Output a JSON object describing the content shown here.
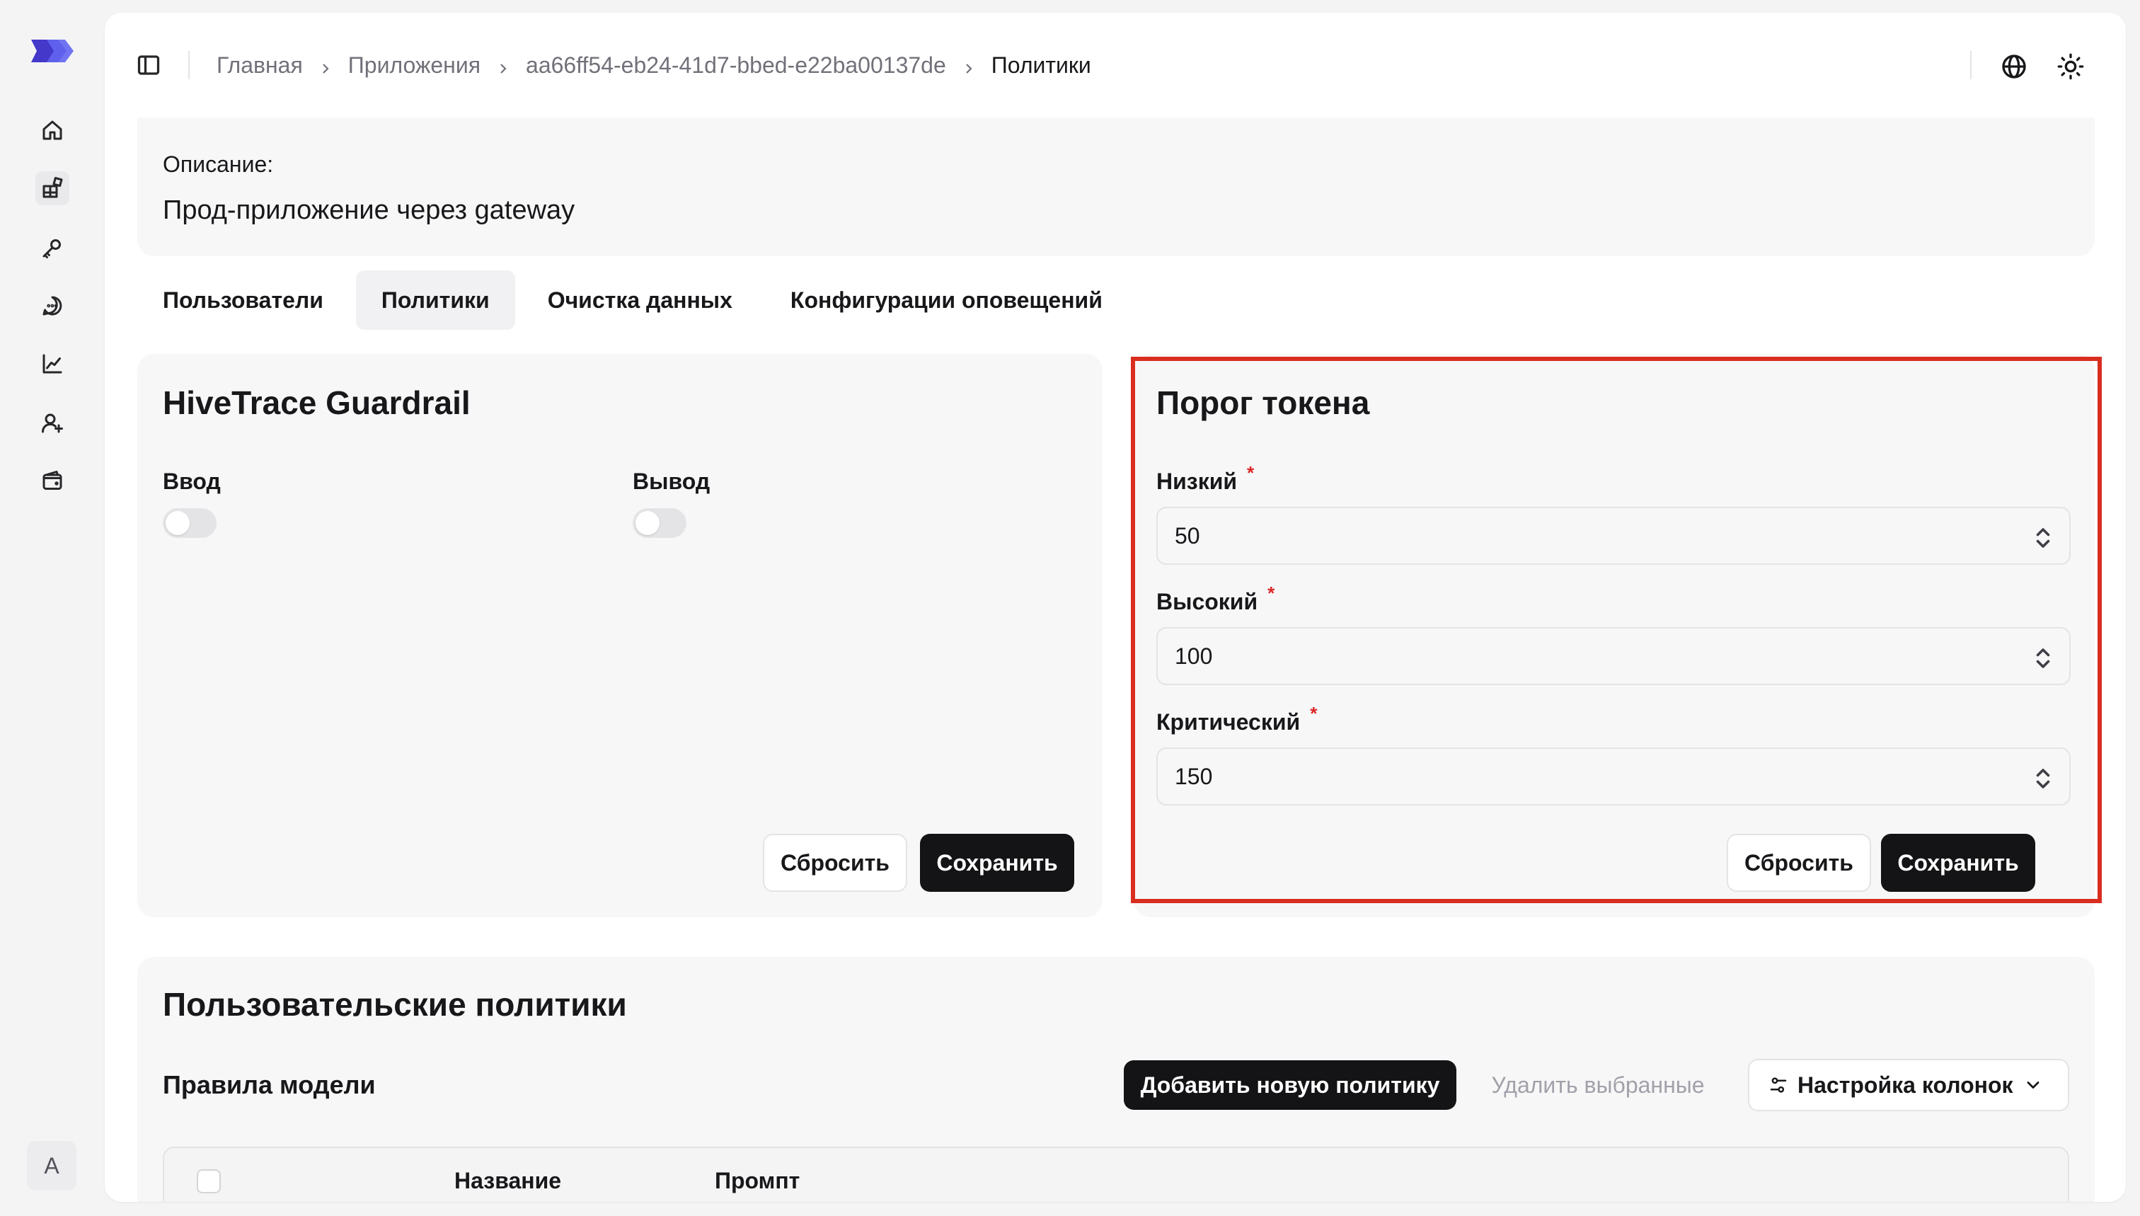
{
  "breadcrumb": {
    "items": [
      "Главная",
      "Приложения",
      "aa66ff54-eb24-41d7-bbed-e22ba00137de"
    ],
    "current": "Политики"
  },
  "user": {
    "avatar_initial": "A"
  },
  "app": {
    "description_label": "Описание:",
    "description_value": "Прод-приложение через gateway"
  },
  "tabs": [
    {
      "label": "Пользователи",
      "active": false
    },
    {
      "label": "Политики",
      "active": true
    },
    {
      "label": "Очистка данных",
      "active": false
    },
    {
      "label": "Конфигурации оповещений",
      "active": false
    }
  ],
  "guardrail": {
    "title": "HiveTrace Guardrail",
    "input_label": "Ввод",
    "output_label": "Вывод",
    "input_enabled": false,
    "output_enabled": false,
    "reset_label": "Сбросить",
    "save_label": "Сохранить"
  },
  "token_threshold": {
    "title": "Порог токена",
    "low_label": "Низкий",
    "low_value": "50",
    "high_label": "Высокий",
    "high_value": "100",
    "critical_label": "Критический",
    "critical_value": "150",
    "required_mark": "*",
    "reset_label": "Сбросить",
    "save_label": "Сохранить"
  },
  "custom_policies": {
    "title": "Пользовательские политики",
    "model_rules_label": "Правила модели",
    "add_button": "Добавить новую политику",
    "delete_button": "Удалить выбранные",
    "columns_button": "Настройка колонок",
    "table_headers": [
      "Название",
      "Промпт"
    ]
  },
  "colors": {
    "accent_logo": "#4f46e5",
    "highlight_border": "#d92d20",
    "dark_button": "#141416",
    "required": "#dc2626"
  },
  "icons": {
    "nav": [
      "home-icon",
      "apps-icon",
      "key-icon",
      "chat-icon",
      "chart-icon",
      "user-plus-icon",
      "wallet-icon"
    ],
    "top": [
      "globe-icon",
      "sun-icon"
    ]
  }
}
